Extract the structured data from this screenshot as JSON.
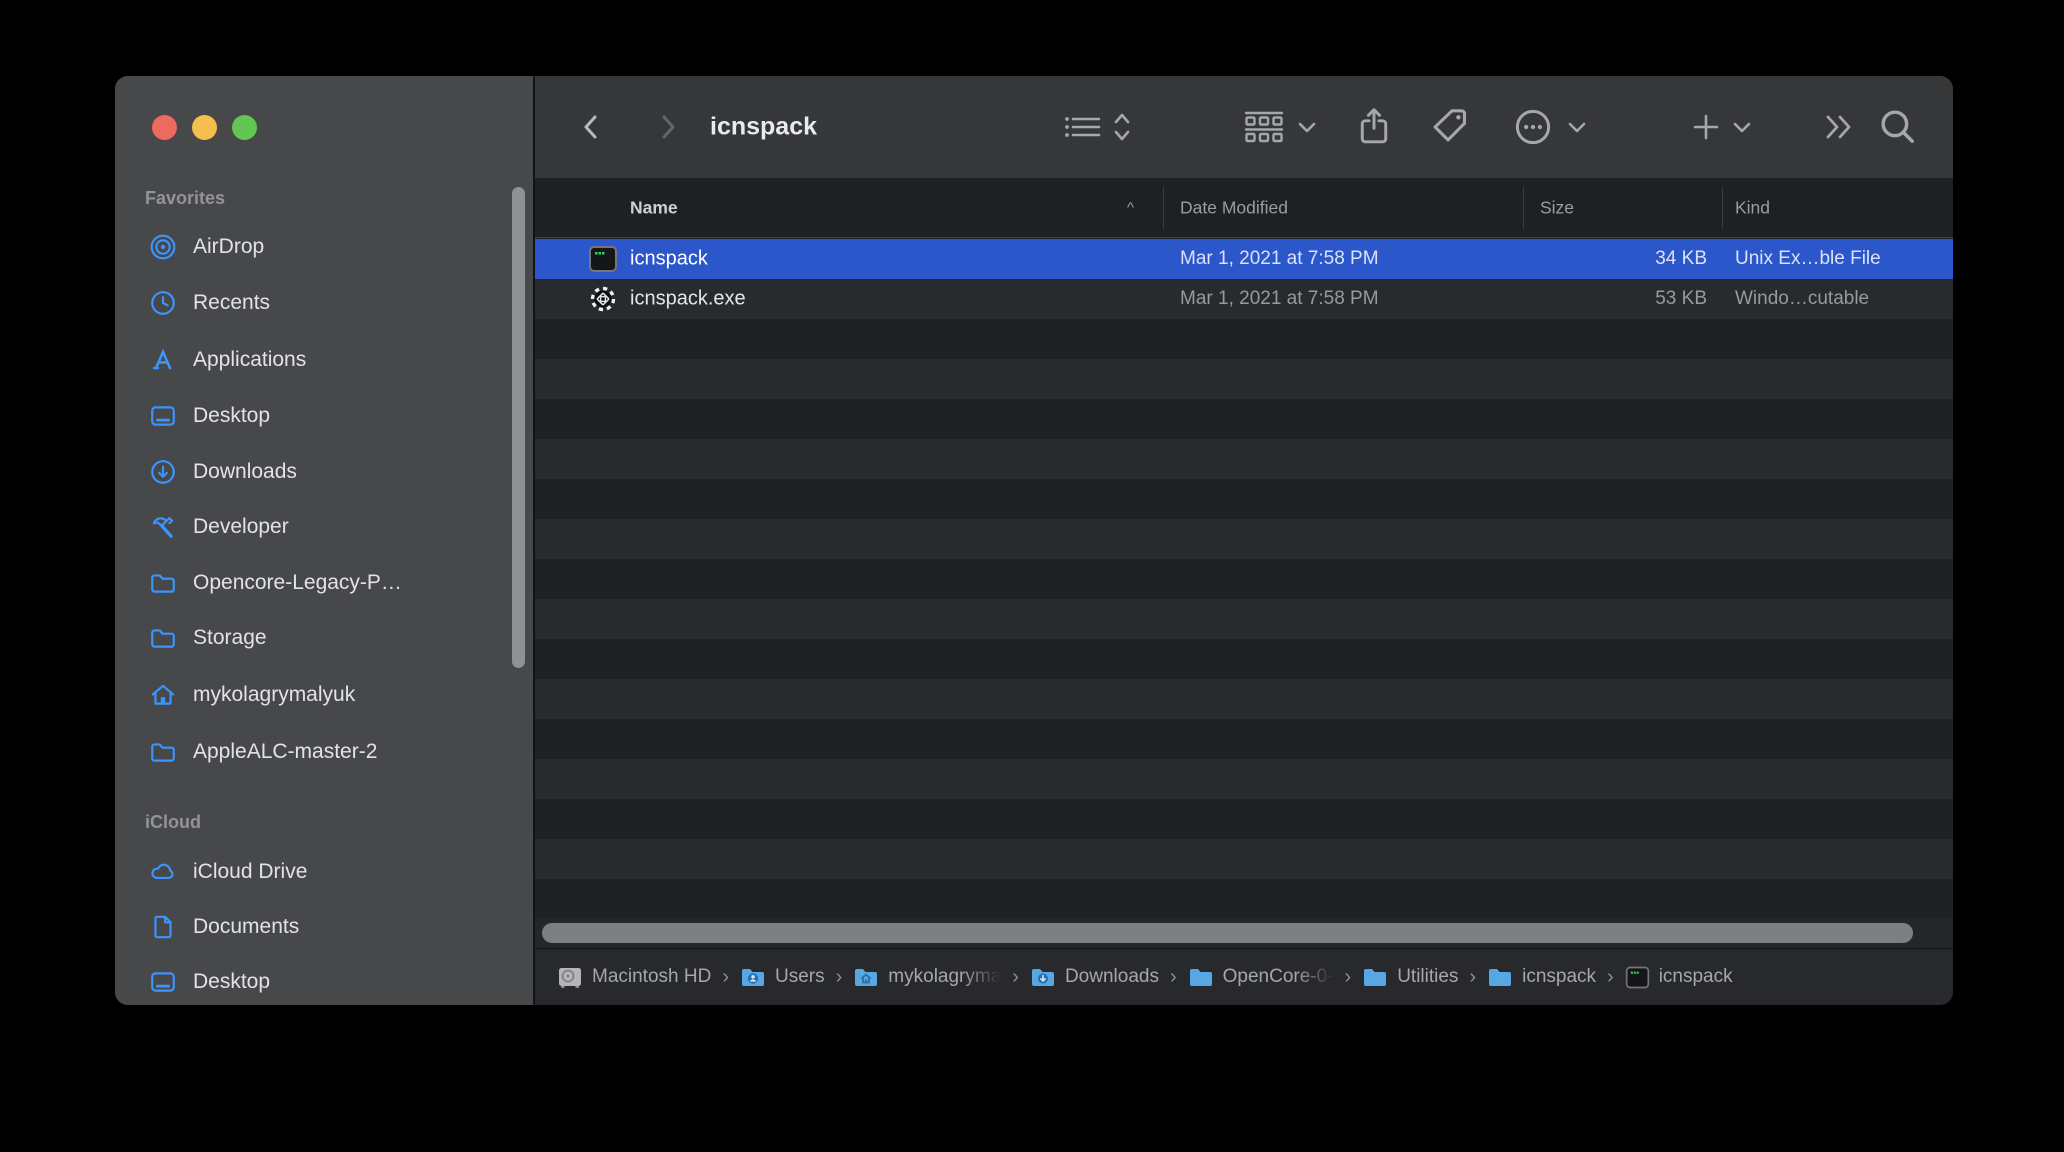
{
  "window": {
    "title": "icnspack"
  },
  "traffic_lights": {
    "close": "#ed6a5f",
    "minimize": "#f5bf4f",
    "zoom": "#62c554"
  },
  "colors": {
    "accent_blue": "#3b95ff",
    "selection_blue": "#2b57ca",
    "sidebar_bg": "#47484a",
    "toolbar_bg": "#353739",
    "folder_blue": "#57a7e4"
  },
  "sidebar": {
    "sections": [
      {
        "label": "Favorites",
        "items": [
          {
            "label": "AirDrop",
            "icon": "airdrop-icon"
          },
          {
            "label": "Recents",
            "icon": "clock-icon"
          },
          {
            "label": "Applications",
            "icon": "appstore-icon"
          },
          {
            "label": "Desktop",
            "icon": "desktop-icon"
          },
          {
            "label": "Downloads",
            "icon": "download-circle-icon"
          },
          {
            "label": "Developer",
            "icon": "hammer-icon"
          },
          {
            "label": "Opencore-Legacy-P…",
            "icon": "folder-icon"
          },
          {
            "label": "Storage",
            "icon": "folder-icon"
          },
          {
            "label": "mykolagrymalyuk",
            "icon": "home-icon"
          },
          {
            "label": "AppleALC-master-2",
            "icon": "folder-icon"
          }
        ]
      },
      {
        "label": "iCloud",
        "items": [
          {
            "label": "iCloud Drive",
            "icon": "cloud-icon"
          },
          {
            "label": "Documents",
            "icon": "document-icon"
          },
          {
            "label": "Desktop",
            "icon": "desktop-icon"
          }
        ]
      }
    ]
  },
  "toolbar": {
    "title": "icnspack",
    "icons": [
      "back-icon",
      "forward-icon",
      "list-view-icon",
      "view-updown-icon",
      "group-icon",
      "share-icon",
      "tag-icon",
      "more-actions-icon",
      "new-folder-plus-icon",
      "overflow-chevrons-icon",
      "search-icon"
    ]
  },
  "list": {
    "columns": {
      "name": "Name",
      "date": "Date Modified",
      "size": "Size",
      "kind": "Kind"
    },
    "sort_indicator": "^",
    "files": [
      {
        "name": "icnspack",
        "date": "Mar 1, 2021 at 7:58 PM",
        "size": "34 KB",
        "kind": "Unix Ex…ble File",
        "icon": "terminal-executable-icon",
        "selected": true
      },
      {
        "name": "icnspack.exe",
        "date": "Mar 1, 2021 at 7:58 PM",
        "size": "53 KB",
        "kind": "Windo…cutable",
        "icon": "gear-exe-icon",
        "selected": false
      }
    ]
  },
  "pathbar": {
    "separator": "›",
    "items": [
      {
        "label": "Macintosh HD",
        "icon": "hard-drive-icon",
        "truncated": false
      },
      {
        "label": "Users",
        "icon": "users-folder-icon",
        "truncated": false
      },
      {
        "label": "mykolagryma",
        "icon": "home-folder-icon",
        "truncated": true
      },
      {
        "label": "Downloads",
        "icon": "downloads-folder-icon",
        "truncated": false
      },
      {
        "label": "OpenCore-0-",
        "icon": "folder-icon",
        "truncated": true
      },
      {
        "label": "Utilities",
        "icon": "folder-icon",
        "truncated": false
      },
      {
        "label": "icnspack",
        "icon": "folder-icon",
        "truncated": false
      },
      {
        "label": "icnspack",
        "icon": "terminal-executable-icon",
        "truncated": false
      }
    ]
  }
}
